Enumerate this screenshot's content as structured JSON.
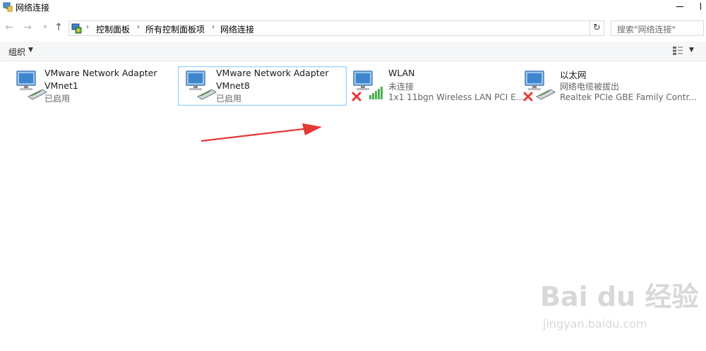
{
  "window": {
    "title": "网络连接",
    "minimize_label": "",
    "accent": "#0078d7"
  },
  "address_bar": {
    "breadcrumbs": [
      "控制面板",
      "所有控制面板项",
      "网络连接"
    ],
    "search_placeholder": "搜索\"网络连接\""
  },
  "toolbar": {
    "organize_label": "组织"
  },
  "connections": [
    {
      "name": "VMware Network Adapter",
      "line2": "VMnet1",
      "status": "已启用",
      "icon": "network-adapter-icon",
      "selected": false
    },
    {
      "name": "VMware Network Adapter",
      "line2": "VMnet8",
      "status": "已启用",
      "icon": "network-adapter-icon",
      "selected": true
    },
    {
      "name": "WLAN",
      "status": "未连接",
      "device": "1x1 11bgn Wireless LAN PCI E...",
      "icon": "wireless-adapter-icon",
      "badge": "disconnected-x-icon"
    },
    {
      "name": "以太网",
      "status": "网络电缆被拔出",
      "device": "Realtek PCIe GBE Family Contr...",
      "icon": "ethernet-adapter-icon",
      "badge": "disconnected-x-icon"
    }
  ],
  "annotation": {
    "arrow_color": "#e53935"
  },
  "watermark": {
    "brand": "Bai du 经验",
    "site": "jingyan.baidu.com"
  }
}
